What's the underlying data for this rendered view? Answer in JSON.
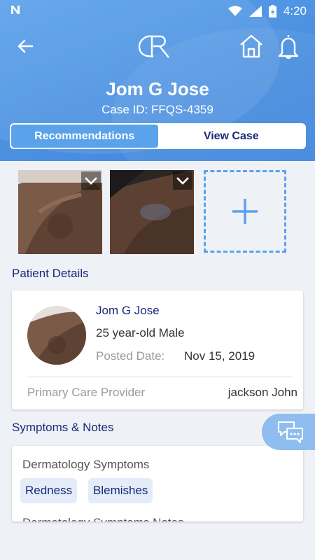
{
  "status_bar": {
    "carrier_icon": "n-icon",
    "time": "4:20"
  },
  "header": {
    "patient_name": "Jom G Jose",
    "case_id": "Case ID: FFQS-4359",
    "tabs": [
      {
        "label": "Recommendations",
        "active": true
      },
      {
        "label": "View Case",
        "active": false
      }
    ]
  },
  "photos": {
    "count": 2,
    "add_icon": "plus-icon"
  },
  "patient_details": {
    "section_title": "Patient Details",
    "name": "Jom G Jose",
    "age_gender": "25 year-old Male",
    "posted_label": "Posted Date:",
    "posted_value": "Nov 15, 2019",
    "pcp_label": "Primary Care Provider",
    "pcp_value": "jackson John"
  },
  "symptoms": {
    "section_title": "Symptoms & Notes",
    "label": "Dermatology Symptoms",
    "chips": [
      "Redness",
      "Blemishes"
    ],
    "notes_label": "Dermatology Symptoms Notes"
  },
  "colors": {
    "primary": "#5aa2ea",
    "navy": "#1b2a78",
    "background": "#eef1f6"
  }
}
